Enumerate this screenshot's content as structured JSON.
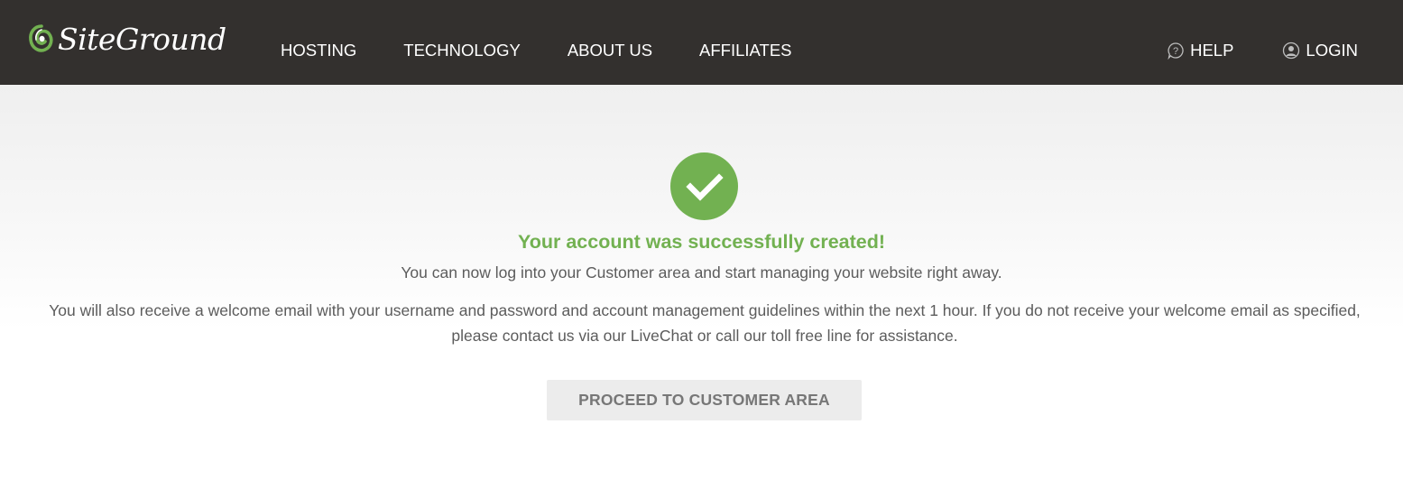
{
  "brand": {
    "logo_text": "SiteGround",
    "logo_color": "#72b151"
  },
  "nav": {
    "items": [
      {
        "label": "HOSTING"
      },
      {
        "label": "TECHNOLOGY"
      },
      {
        "label": "ABOUT US"
      },
      {
        "label": "AFFILIATES"
      }
    ],
    "help": {
      "label": "HELP",
      "icon": "help-icon"
    },
    "login": {
      "label": "LOGIN",
      "icon": "user-icon"
    }
  },
  "main": {
    "status_icon": "checkmark-icon",
    "title": "Your account was successfully created!",
    "message_1": "You can now log into your Customer area and start managing your website right away.",
    "message_2": "You will also receive a welcome email with your username and password and account management guidelines within the next 1 hour. If you do not receive your welcome email as specified, please contact us via our LiveChat or call our toll free line for assistance.",
    "proceed_button": "PROCEED TO CUSTOMER AREA"
  },
  "colors": {
    "header_bg": "#33302e",
    "accent_green": "#72b151",
    "body_text": "#5c5c5c",
    "button_bg": "#ececec",
    "button_text": "#777777"
  }
}
